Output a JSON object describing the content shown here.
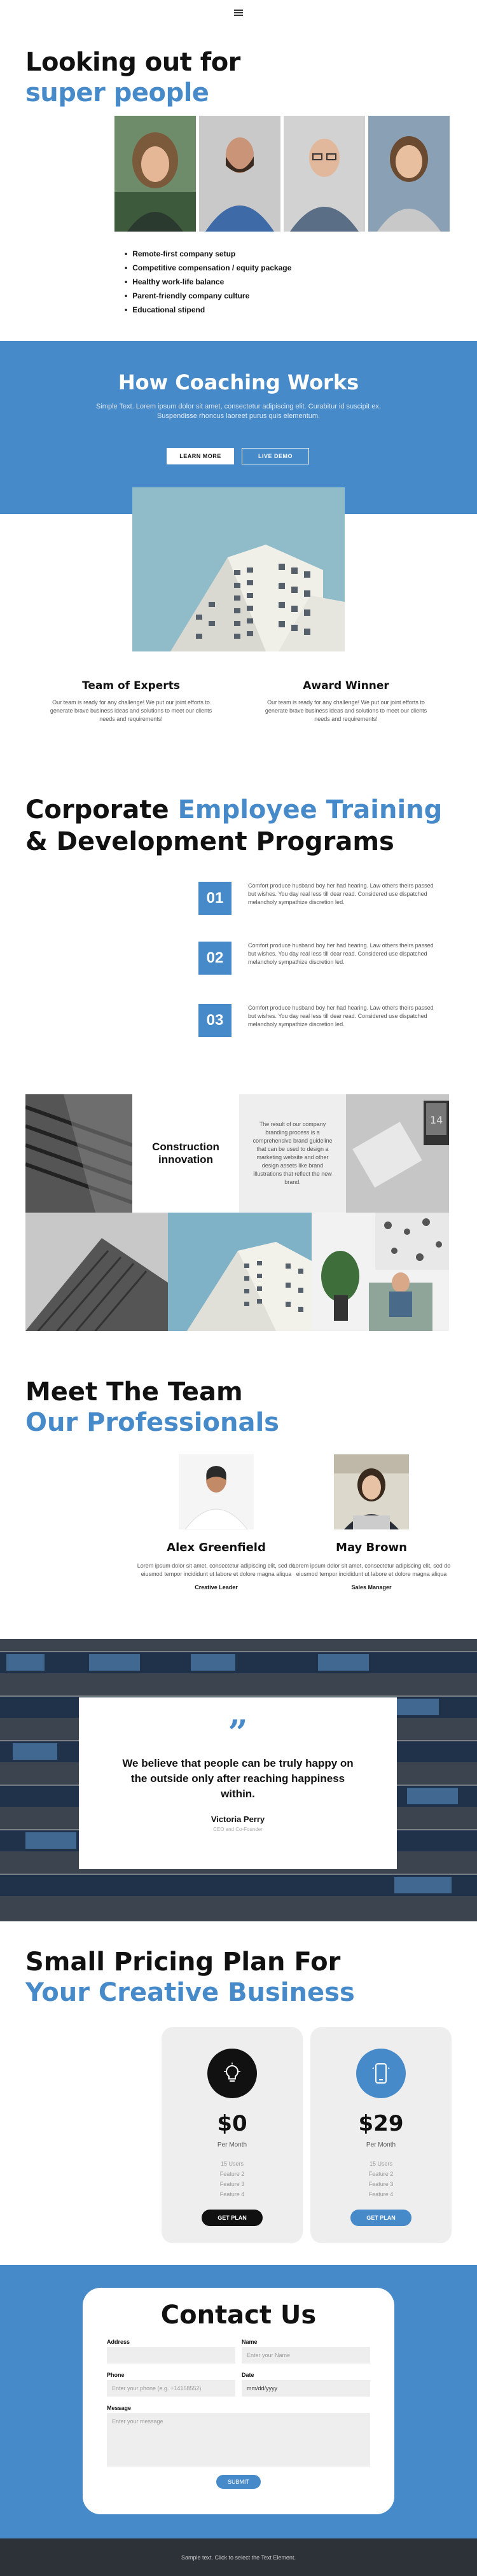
{
  "hero": {
    "title_line1": "Looking out for",
    "title_line2": "super people",
    "perks": [
      "Remote-first company setup",
      "Competitive compensation / equity package",
      "Healthy work-life balance",
      "Parent-friendly company culture",
      "Educational stipend"
    ]
  },
  "coaching": {
    "title": "How Coaching Works",
    "text": "Simple Text. Lorem ipsum dolor sit amet, consectetur adipiscing elit. Curabitur id suscipit ex. Suspendisse rhoncus laoreet purus quis elementum.",
    "learn_more": "LEARN MORE",
    "live_demo": "LIVE DEMO"
  },
  "features": [
    {
      "title": "Team of Experts",
      "text": "Our team is ready for any challenge! We put our joint efforts to generate brave business ideas and solutions to meet our clients needs and requirements!"
    },
    {
      "title": "Award Winner",
      "text": "Our team is ready for any challenge! We put our joint efforts to generate brave business ideas and solutions to meet our clients needs and requirements!"
    }
  ],
  "programs": {
    "title_a": "Corporate ",
    "title_b": "Employee Training",
    "title_c": "& Development Programs",
    "items": [
      {
        "num": "01",
        "text": "Comfort produce husband boy her had hearing. Law others theirs passed but wishes. You day real less till dear read. Considered use dispatched melancholy sympathize discretion led."
      },
      {
        "num": "02",
        "text": "Comfort produce husband boy her had hearing. Law others theirs passed but wishes. You day real less till dear read. Considered use dispatched melancholy sympathize discretion led."
      },
      {
        "num": "03",
        "text": "Comfort produce husband boy her had hearing. Law others theirs passed but wishes. You day real less till dear read. Considered use dispatched melancholy sympathize discretion led."
      }
    ]
  },
  "gallery": {
    "label": "Construction innovation",
    "text": "The result of our company branding process is a comprehensive brand guideline that can be used to design a marketing website and other design assets like brand illustrations that reflect the new brand.",
    "laptop_text": "14"
  },
  "team": {
    "title_line1": "Meet The Team",
    "title_line2": "Our Professionals",
    "members": [
      {
        "name": "Alex Greenfield",
        "text": "Lorem ipsum dolor sit amet, consectetur adipiscing elit, sed do eiusmod tempor incididunt ut labore et dolore magna aliqua",
        "role": "Creative Leader"
      },
      {
        "name": "May Brown",
        "text": "Lorem ipsum dolor sit amet, consectetur adipiscing elit, sed do eiusmod tempor incididunt ut labore et dolore magna aliqua",
        "role": "Sales Manager"
      }
    ]
  },
  "quote": {
    "text": "We believe that people can be truly happy on the outside only after reaching happiness within.",
    "author": "Victoria Perry",
    "role": "CEO and Co-Founder"
  },
  "pricing": {
    "title_line1": "Small Pricing Plan For",
    "title_line2": "Your Creative Business",
    "plans": [
      {
        "price": "$0",
        "period": "Per Month",
        "features": [
          "15 Users",
          "Feature 2",
          "Feature 3",
          "Feature 4"
        ],
        "button": "GET PLAN",
        "icon": "lightbulb-icon"
      },
      {
        "price": "$29",
        "period": "Per Month",
        "features": [
          "15 Users",
          "Feature 2",
          "Feature 3",
          "Feature 4"
        ],
        "button": "GET PLAN",
        "icon": "phone-icon"
      }
    ]
  },
  "contact": {
    "title": "Contact Us",
    "address_label": "Address",
    "name_label": "Name",
    "name_placeholder": "Enter your Name",
    "phone_label": "Phone",
    "phone_placeholder": "Enter your phone (e.g. +14158552)",
    "date_label": "Date",
    "date_placeholder": "mm/dd/yyyy",
    "message_label": "Message",
    "message_placeholder": "Enter your message",
    "submit": "SUBMIT"
  },
  "footer": {
    "text": "Sample text. Click to select the Text Element."
  },
  "colors": {
    "accent": "#478ac9",
    "dark": "#2d3238"
  }
}
